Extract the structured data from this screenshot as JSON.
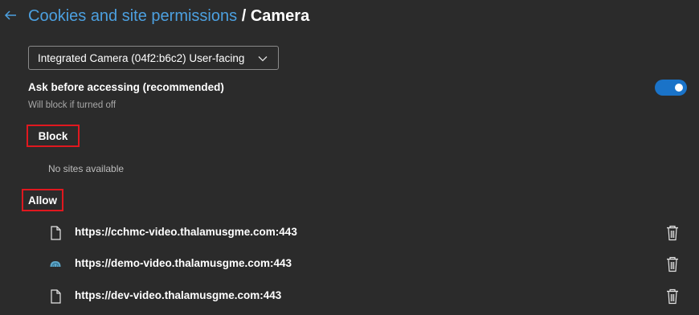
{
  "header": {
    "breadcrumb_parent": "Cookies and site permissions",
    "separator": "/",
    "current": "Camera"
  },
  "device_select": {
    "selected": "Integrated Camera (04f2:b6c2) User-facing"
  },
  "ask_setting": {
    "label": "Ask before accessing (recommended)",
    "sublabel": "Will block if turned off",
    "enabled": true
  },
  "block": {
    "title": "Block",
    "empty_message": "No sites available"
  },
  "allow": {
    "title": "Allow",
    "sites": [
      {
        "url": "https://cchmc-video.thalamusgme.com:443",
        "icon": "page-icon"
      },
      {
        "url": "https://demo-video.thalamusgme.com:443",
        "icon": "site-favicon-brain-icon"
      },
      {
        "url": "https://dev-video.thalamusgme.com:443",
        "icon": "page-icon"
      }
    ]
  },
  "colors": {
    "background": "#2b2b2b",
    "link": "#4ca0e0",
    "toggle_on": "#1a73c8",
    "highlight_box": "#e0181f"
  }
}
